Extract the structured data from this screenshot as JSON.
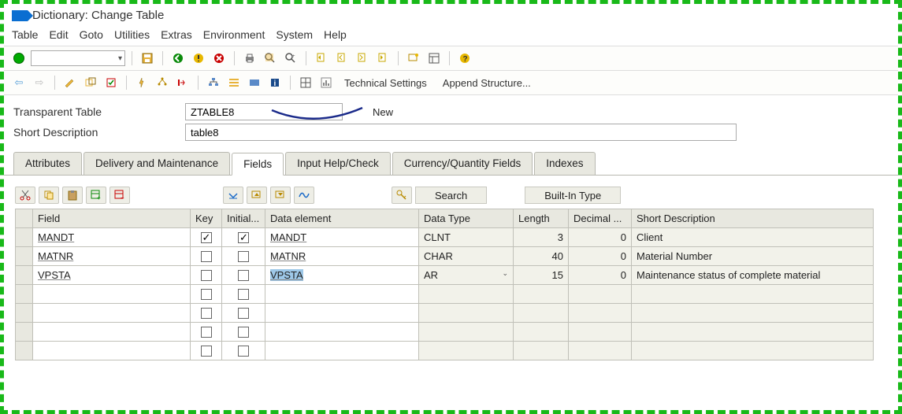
{
  "window": {
    "title": "Dictionary: Change Table"
  },
  "menu": {
    "items": [
      "Table",
      "Edit",
      "Goto",
      "Utilities",
      "Extras",
      "Environment",
      "System",
      "Help"
    ]
  },
  "app_toolbar": {
    "technical_settings": "Technical Settings",
    "append_structure": "Append Structure..."
  },
  "header": {
    "type_label": "Transparent Table",
    "name_value": "ZTABLE8",
    "status": "New",
    "desc_label": "Short Description",
    "desc_value": "table8"
  },
  "tabs": {
    "items": [
      "Attributes",
      "Delivery and Maintenance",
      "Fields",
      "Input Help/Check",
      "Currency/Quantity Fields",
      "Indexes"
    ],
    "active": 2
  },
  "grid": {
    "search_btn": "Search",
    "builtin_btn": "Built-In Type",
    "columns": {
      "field": "Field",
      "key": "Key",
      "initial": "Initial...",
      "data_element": "Data element",
      "data_type": "Data Type",
      "length": "Length",
      "decimal": "Decimal ...",
      "short_desc": "Short Description"
    },
    "rows": [
      {
        "field": "MANDT",
        "key": true,
        "initial": true,
        "element": "MANDT",
        "dtype": "CLNT",
        "len": "3",
        "dec": "0",
        "desc": "Client",
        "selected": false,
        "dropdown": false
      },
      {
        "field": "MATNR",
        "key": false,
        "initial": false,
        "element": "MATNR",
        "dtype": "CHAR",
        "len": "40",
        "dec": "0",
        "desc": "Material Number",
        "selected": false,
        "dropdown": false
      },
      {
        "field": "VPSTA",
        "key": false,
        "initial": false,
        "element": "VPSTA",
        "dtype": "AR",
        "len": "15",
        "dec": "0",
        "desc": "Maintenance status of complete material",
        "selected": true,
        "dropdown": true
      }
    ],
    "empty_rows": 4
  },
  "icons": {
    "save": "save-icon",
    "back": "back-icon",
    "exit": "exit-icon",
    "cancel": "cancel-icon",
    "print": "print-icon",
    "find": "find-icon",
    "findnext": "find-next-icon",
    "firstpage": "first-page-icon",
    "prevpage": "prev-page-icon",
    "nextpage": "next-page-icon",
    "lastpage": "last-page-icon",
    "newwindow": "new-window-icon",
    "layout": "layout-icon",
    "help": "help-icon",
    "cut": "cut-icon",
    "copy": "copy-icon",
    "paste": "paste-icon",
    "insert": "insert-row-icon",
    "delete": "delete-row-icon",
    "expand": "expand-icon",
    "collapse": "collapse-icon",
    "predef": "predef-icon"
  }
}
